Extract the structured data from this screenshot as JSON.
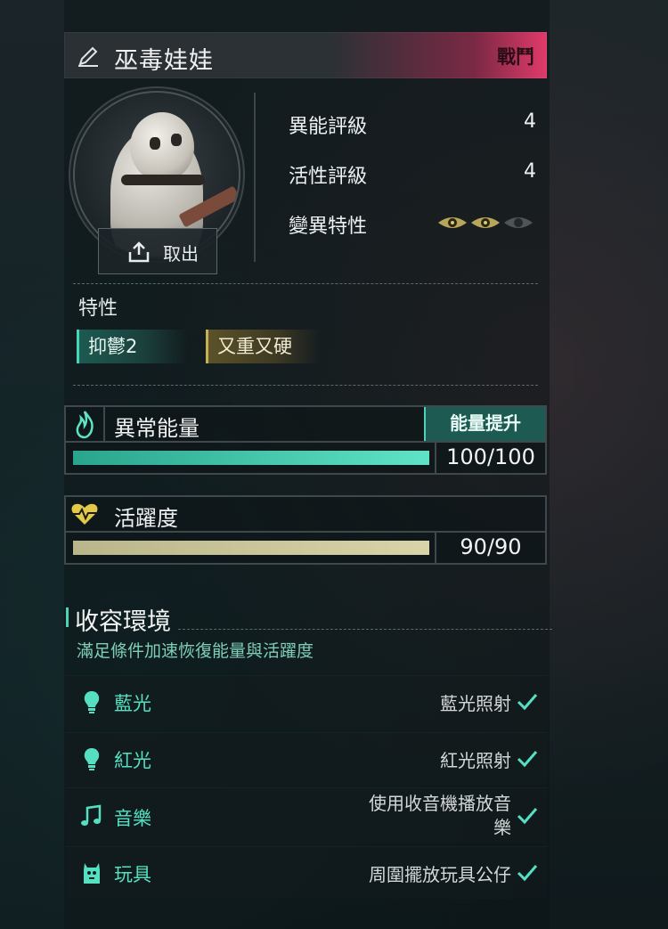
{
  "header": {
    "name": "巫毒娃娃",
    "badge": "戰鬥",
    "accent": "#e03a6a"
  },
  "portrait": {
    "take_out_label": "取出"
  },
  "stats": [
    {
      "label": "異能評級",
      "value": "4"
    },
    {
      "label": "活性評級",
      "value": "4"
    },
    {
      "label": "變異特性",
      "value": ""
    }
  ],
  "mutation_eyes": {
    "filled": 2,
    "total": 3
  },
  "traits": {
    "title": "特性",
    "items": [
      "抑鬱2",
      "又重又硬"
    ]
  },
  "energy": {
    "title": "異常能量",
    "boost_label": "能量提升",
    "value_text": "100/100",
    "fraction": 1.0,
    "color": "#5fe3c6"
  },
  "vitality": {
    "title": "活躍度",
    "value_text": "90/90",
    "fraction": 1.0,
    "color": "#d8d4a8"
  },
  "environment": {
    "title": "收容環境",
    "subtitle": "滿足條件加速恢復能量與活躍度",
    "rows": [
      {
        "icon": "bulb-icon",
        "name": "藍光",
        "condition": "藍光照射"
      },
      {
        "icon": "bulb-icon",
        "name": "紅光",
        "condition": "紅光照射"
      },
      {
        "icon": "music-note-icon",
        "name": "音樂",
        "condition_line1": "使用收音機播放音",
        "condition_line2": "樂"
      },
      {
        "icon": "toy-icon",
        "name": "玩具",
        "condition": "周圍擺放玩具公仔"
      }
    ],
    "accent": "#56e0c2"
  }
}
